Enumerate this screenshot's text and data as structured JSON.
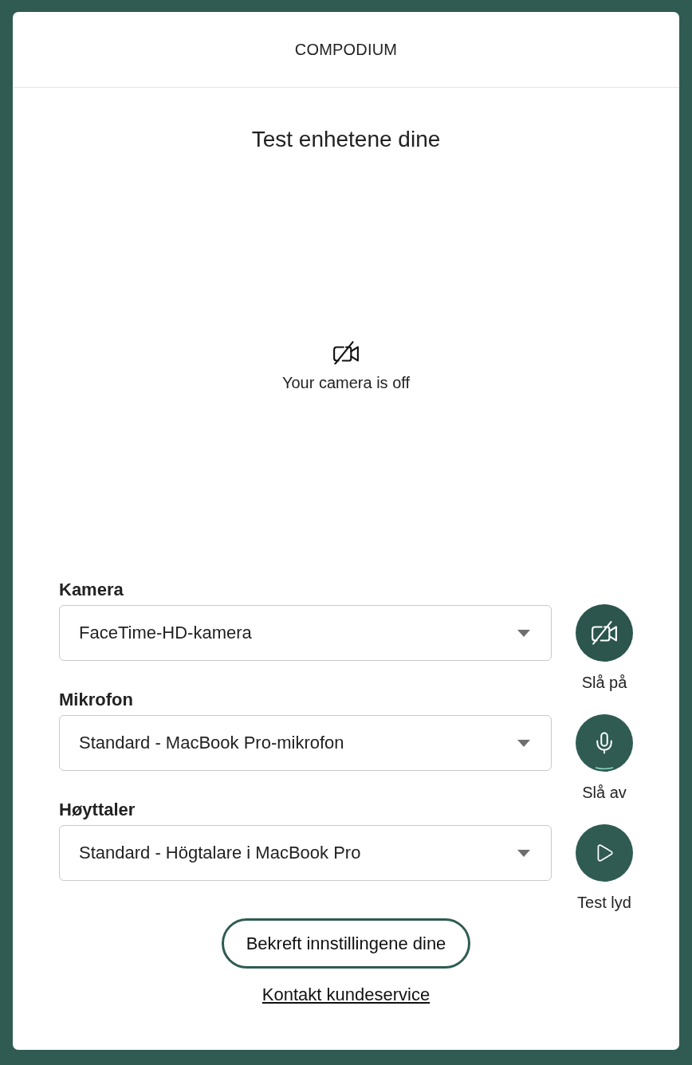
{
  "header": {
    "brand": "COMPODIUM"
  },
  "title": "Test enhetene dine",
  "preview": {
    "camera_on": false,
    "message": "Your camera is off"
  },
  "devices": [
    {
      "kind": "camera",
      "label": "Kamera",
      "value": "FaceTime-HD-kamera",
      "on": false,
      "action": "Slå på"
    },
    {
      "kind": "microphone",
      "label": "Mikrofon",
      "value": "Standard - MacBook Pro-mikrofon",
      "on": true,
      "action": "Slå av"
    },
    {
      "kind": "speaker",
      "label": "Høyttaler",
      "value": "Standard - Högtalare i MacBook Pro",
      "action": "Test lyd"
    }
  ],
  "confirm_button": "Bekreft innstillingene dine",
  "support_link": "Kontakt kundeservice"
}
